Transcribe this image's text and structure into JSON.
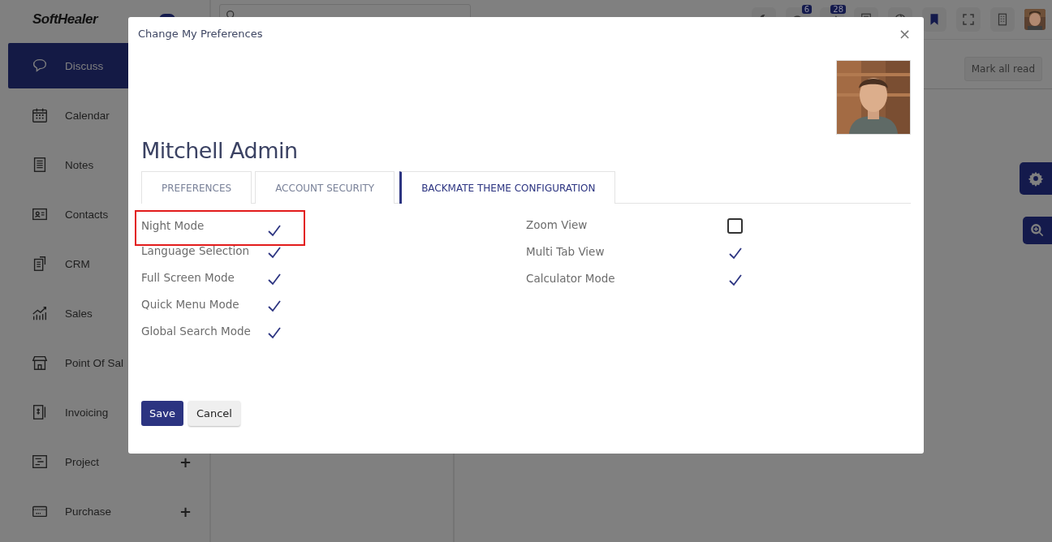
{
  "brand": {
    "logo": "SoftHealer"
  },
  "topbar": {
    "badges": [
      {
        "count": "6"
      },
      {
        "count": "28"
      }
    ]
  },
  "sidebar": {
    "items": [
      {
        "label": "Discuss",
        "selected": true
      },
      {
        "label": "Calendar",
        "selected": false
      },
      {
        "label": "Notes",
        "selected": false
      },
      {
        "label": "Contacts",
        "selected": false
      },
      {
        "label": "CRM",
        "selected": false
      },
      {
        "label": "Sales",
        "selected": false
      },
      {
        "label": "Point Of Sal",
        "selected": false
      },
      {
        "label": "Invoicing",
        "selected": false
      },
      {
        "label": "Project",
        "selected": false,
        "toggle": "+"
      },
      {
        "label": "Purchase",
        "selected": false,
        "toggle": "+"
      }
    ]
  },
  "toolbar": {
    "button": "Mark all read"
  },
  "dialog": {
    "title": "Change My Preferences",
    "close": "×",
    "name": "Mitchell Admin",
    "tabs": [
      {
        "label": "PREFERENCES",
        "selected": false
      },
      {
        "label": "ACCOUNT SECURITY",
        "selected": false
      },
      {
        "label": "BACKMATE THEME CONFIGURATION",
        "selected": true
      }
    ],
    "columns": [
      [
        {
          "label": "Night Mode",
          "checked": true,
          "highlighted": true
        },
        {
          "label": "Language Selection",
          "checked": true,
          "highlighted": false
        },
        {
          "label": "Full Screen Mode",
          "checked": true,
          "highlighted": false
        },
        {
          "label": "Quick Menu Mode",
          "checked": true,
          "highlighted": false
        },
        {
          "label": "Global Search Mode",
          "checked": true,
          "highlighted": false
        }
      ],
      [
        {
          "label": "Zoom View",
          "checked": false,
          "highlighted": false
        },
        {
          "label": "Multi Tab View",
          "checked": true,
          "highlighted": false
        },
        {
          "label": "Calculator Mode",
          "checked": true,
          "highlighted": false
        }
      ]
    ],
    "buttons": [
      {
        "label": "Save",
        "kind": "primary"
      },
      {
        "label": "Cancel",
        "kind": "secondary"
      }
    ]
  }
}
